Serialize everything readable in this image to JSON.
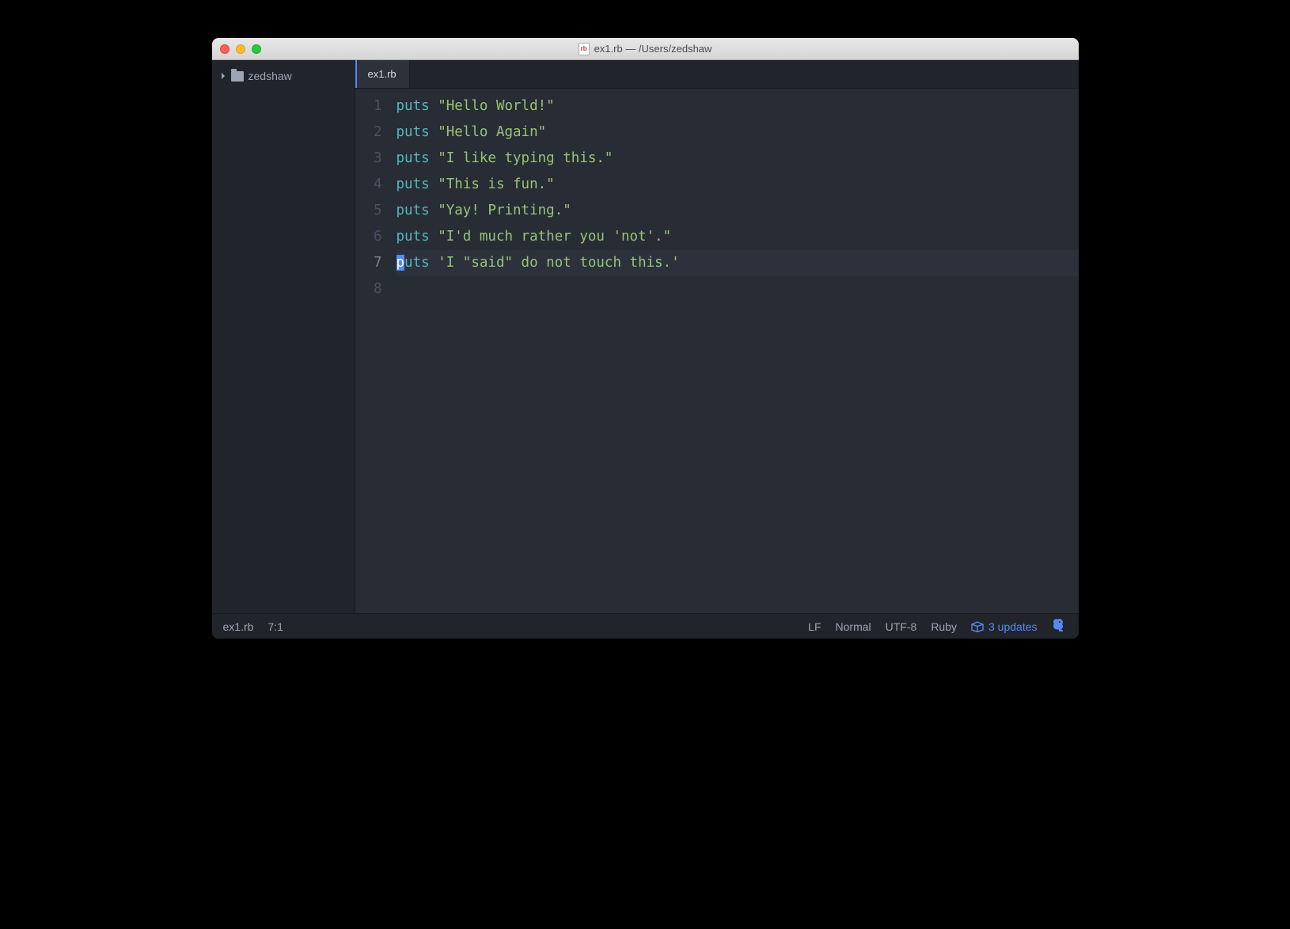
{
  "window": {
    "title": "ex1.rb — /Users/zedshaw"
  },
  "sidebar": {
    "root_folder": "zedshaw"
  },
  "tabs": [
    {
      "label": "ex1.rb",
      "active": true
    }
  ],
  "editor": {
    "cursor_line": 7,
    "lines": [
      {
        "n": 1,
        "tokens": [
          {
            "t": "kw",
            "v": "puts"
          },
          {
            "t": "sp",
            "v": " "
          },
          {
            "t": "str",
            "v": "\"Hello World!\""
          }
        ]
      },
      {
        "n": 2,
        "tokens": [
          {
            "t": "kw",
            "v": "puts"
          },
          {
            "t": "sp",
            "v": " "
          },
          {
            "t": "str",
            "v": "\"Hello Again\""
          }
        ]
      },
      {
        "n": 3,
        "tokens": [
          {
            "t": "kw",
            "v": "puts"
          },
          {
            "t": "sp",
            "v": " "
          },
          {
            "t": "str",
            "v": "\"I like typing this.\""
          }
        ]
      },
      {
        "n": 4,
        "tokens": [
          {
            "t": "kw",
            "v": "puts"
          },
          {
            "t": "sp",
            "v": " "
          },
          {
            "t": "str",
            "v": "\"This is fun.\""
          }
        ]
      },
      {
        "n": 5,
        "tokens": [
          {
            "t": "kw",
            "v": "puts"
          },
          {
            "t": "sp",
            "v": " "
          },
          {
            "t": "str",
            "v": "\"Yay! Printing.\""
          }
        ]
      },
      {
        "n": 6,
        "tokens": [
          {
            "t": "kw",
            "v": "puts"
          },
          {
            "t": "sp",
            "v": " "
          },
          {
            "t": "str",
            "v": "\"I'd much rather you 'not'.\""
          }
        ]
      },
      {
        "n": 7,
        "tokens": [
          {
            "t": "cursor",
            "v": "p"
          },
          {
            "t": "kw",
            "v": "uts"
          },
          {
            "t": "sp",
            "v": " "
          },
          {
            "t": "str",
            "v": "'I \"said\" do not touch this.'"
          }
        ]
      },
      {
        "n": 8,
        "tokens": []
      }
    ]
  },
  "statusbar": {
    "filename": "ex1.rb",
    "position": "7:1",
    "line_ending": "LF",
    "mode": "Normal",
    "encoding": "UTF-8",
    "language": "Ruby",
    "updates_label": "3 updates"
  }
}
